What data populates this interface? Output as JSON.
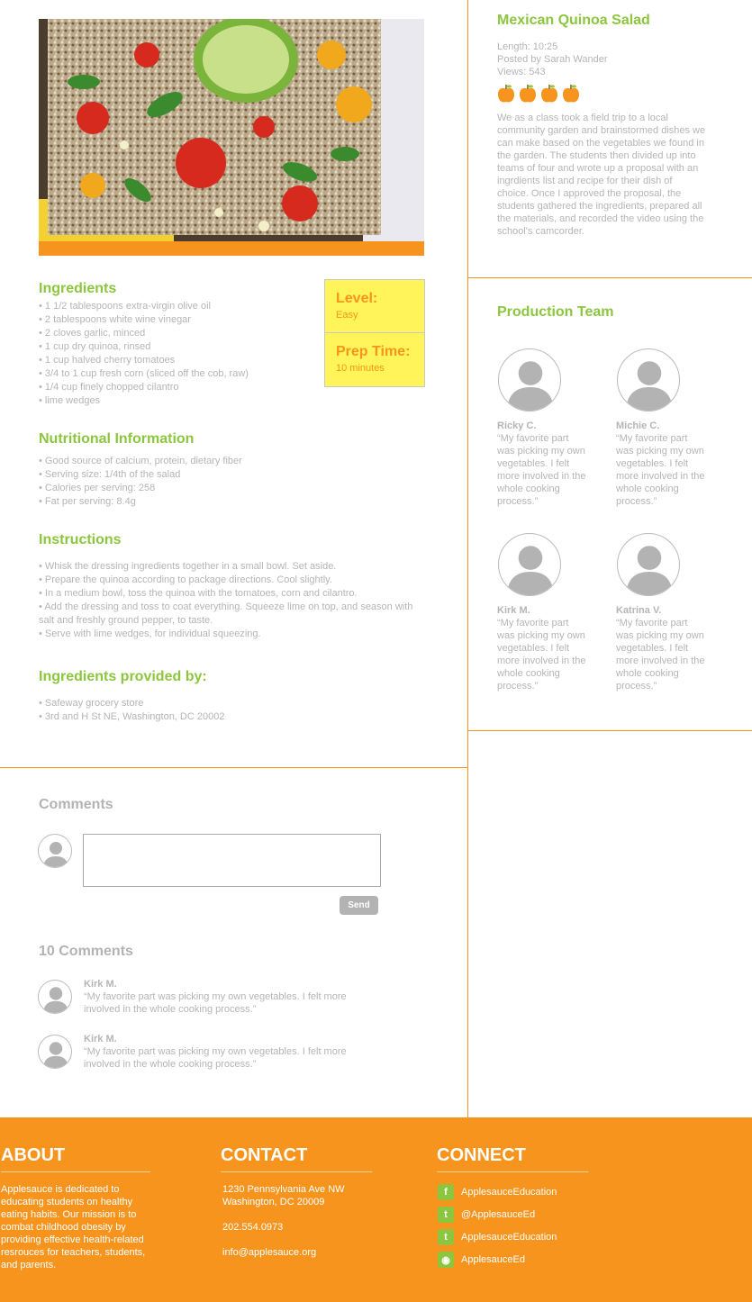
{
  "recipe": {
    "title": "Mexican Quinoa Salad",
    "length": "Length: 10:25",
    "posted_by": "Posted by Sarah Wander",
    "views": "Views: 543",
    "rating": 4,
    "description": "We as a class took a field trip to a local community garden and brainstormed dishes we can make based on the vegetables we found in the garden. The students then divided up into teams of four and wrote up a proposal with an ingrdients list and recipe for their dish of choice. Once I approved the proposal, the students gathered the ingredients, prepared all the materials, and recorded the video using the school's camcorder."
  },
  "info": {
    "level_label": "Level:",
    "level_value": "Easy",
    "prep_label": "Prep Time:",
    "prep_value": "10 minutes"
  },
  "ingredients": {
    "title": "Ingredients",
    "items": [
      "1 1/2 tablespoons extra-virgin olive oil",
      "2 tablespoons white wine vinegar",
      "2 cloves garlic, minced",
      "1 cup dry quinoa, rinsed",
      "1 cup halved cherry tomatoes",
      "3/4 to 1 cup fresh corn (sliced off the cob, raw)",
      "1/4 cup finely chopped cilantro",
      "lime wedges"
    ]
  },
  "nutrition": {
    "title": "Nutritional Information",
    "items": [
      "Good source of calcium, protein, dietary fiber",
      "Serving size: 1/4th of the salad",
      "Calories per serving: 258",
      "Fat per serving: 8.4g"
    ]
  },
  "instructions": {
    "title": "Instructions",
    "items": [
      "Whisk the dressing ingredients together in a small bowl. Set aside.",
      "Prepare the quinoa according to package directions. Cool slightly.",
      "In a medium bowl, toss the quinoa with the tomatoes, corn and cilantro.",
      "Add the dressing and toss to coat everything. Squeeze lime on top, and season with salt and freshly ground pepper, to taste.",
      "Serve with lime wedges, for individual squeezing."
    ]
  },
  "provided": {
    "title": "Ingredients provided by:",
    "items": [
      "Safeway grocery store",
      "3rd and H St NE, Washington, DC 20002"
    ]
  },
  "team": {
    "title": "Production Team",
    "members": [
      {
        "name": "Ricky C.",
        "quote": "“My favorite part was picking my own vegetables. I felt more involved in the whole cooking process.”"
      },
      {
        "name": "Michie C.",
        "quote": "“My favorite part was picking my own vegetables. I felt more involved in the whole cooking process.”"
      },
      {
        "name": "Kirk M.",
        "quote": "“My favorite part was picking my own vegetables. I felt more involved in the whole cooking process.”"
      },
      {
        "name": "Katrina V.",
        "quote": "“My favorite part was picking my own vegetables. I felt more involved in the whole cooking process.”"
      }
    ]
  },
  "comments": {
    "title": "Comments",
    "send_label": "Send",
    "count_label": "10 Comments",
    "items": [
      {
        "name": "Kirk M.",
        "text": "“My favorite part was picking my own vegetables. I felt more involved in the whole cooking process.”"
      },
      {
        "name": "Kirk M.",
        "text": "“My favorite part was picking my own vegetables. I felt more involved in the whole cooking process.”"
      }
    ]
  },
  "footer": {
    "about_title": "ABOUT",
    "about_text": "Applesauce is dedicated to educating students on healthy eating habits. Our mission is to combat childhood obesity by providing effective health-related resrouces for teachers, students, and parents.",
    "contact_title": "CONTACT",
    "address_line1": "1230 Pennsylvania Ave NW",
    "address_line2": "Washington, DC 20009",
    "phone": "202.554.0973",
    "email": "info@applesauce.org",
    "connect_title": "CONNECT",
    "social": [
      {
        "icon": "facebook-icon",
        "glyph": "f",
        "label": "ApplesauceEducation"
      },
      {
        "icon": "twitter-icon",
        "glyph": "t",
        "label": "@ApplesauceEd"
      },
      {
        "icon": "tumblr-icon",
        "glyph": "t",
        "label": "ApplesauceEducation"
      },
      {
        "icon": "camera-icon",
        "glyph": "◉",
        "label": "ApplesauceEd"
      }
    ]
  },
  "colors": {
    "accent": "#f7941d",
    "green": "#8cc63f",
    "yellow": "#fff55a"
  }
}
